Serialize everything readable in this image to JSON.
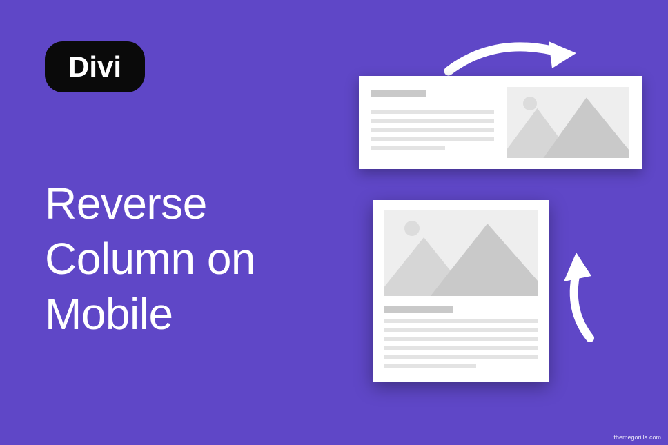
{
  "badge": {
    "label": "Divi"
  },
  "headline": {
    "line1": "Reverse",
    "line2": "Column on",
    "line3": "Mobile"
  },
  "attribution": "themegorilla.com"
}
